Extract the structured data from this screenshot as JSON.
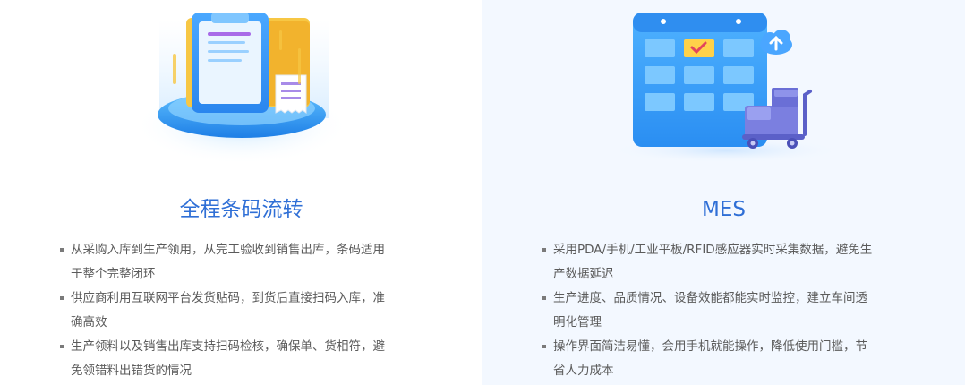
{
  "features": [
    {
      "title": "全程条码流转",
      "icon": "clipboard-document-illustration",
      "bullets": [
        [
          "从采购入库到生产领用，从完工验收到销售出库，条码适用",
          "于整个完整闭环"
        ],
        [
          "供应商利用互联网平台发货贴码，到货后直接扫码入库，准",
          "确高效"
        ],
        [
          "生产领料以及销售出库支持扫码检核，确保单、货相符，避",
          "免领错料出错货的情况"
        ]
      ]
    },
    {
      "title": "MES",
      "icon": "calendar-cart-cloud-illustration",
      "bullets": [
        [
          "采用PDA/手机/工业平板/RFID感应器实时采集数据，避免生",
          "产数据延迟"
        ],
        [
          "生产进度、品质情况、设备效能都能实时监控，建立车间透",
          "明化管理"
        ],
        [
          "操作界面简洁易懂，会用手机就能操作，降低使用门槛，节",
          "省人力成本"
        ]
      ]
    }
  ],
  "colors": {
    "accent": "#2f6fd6",
    "right_bg": "#f3f8ff",
    "text": "#5b5b5b"
  }
}
